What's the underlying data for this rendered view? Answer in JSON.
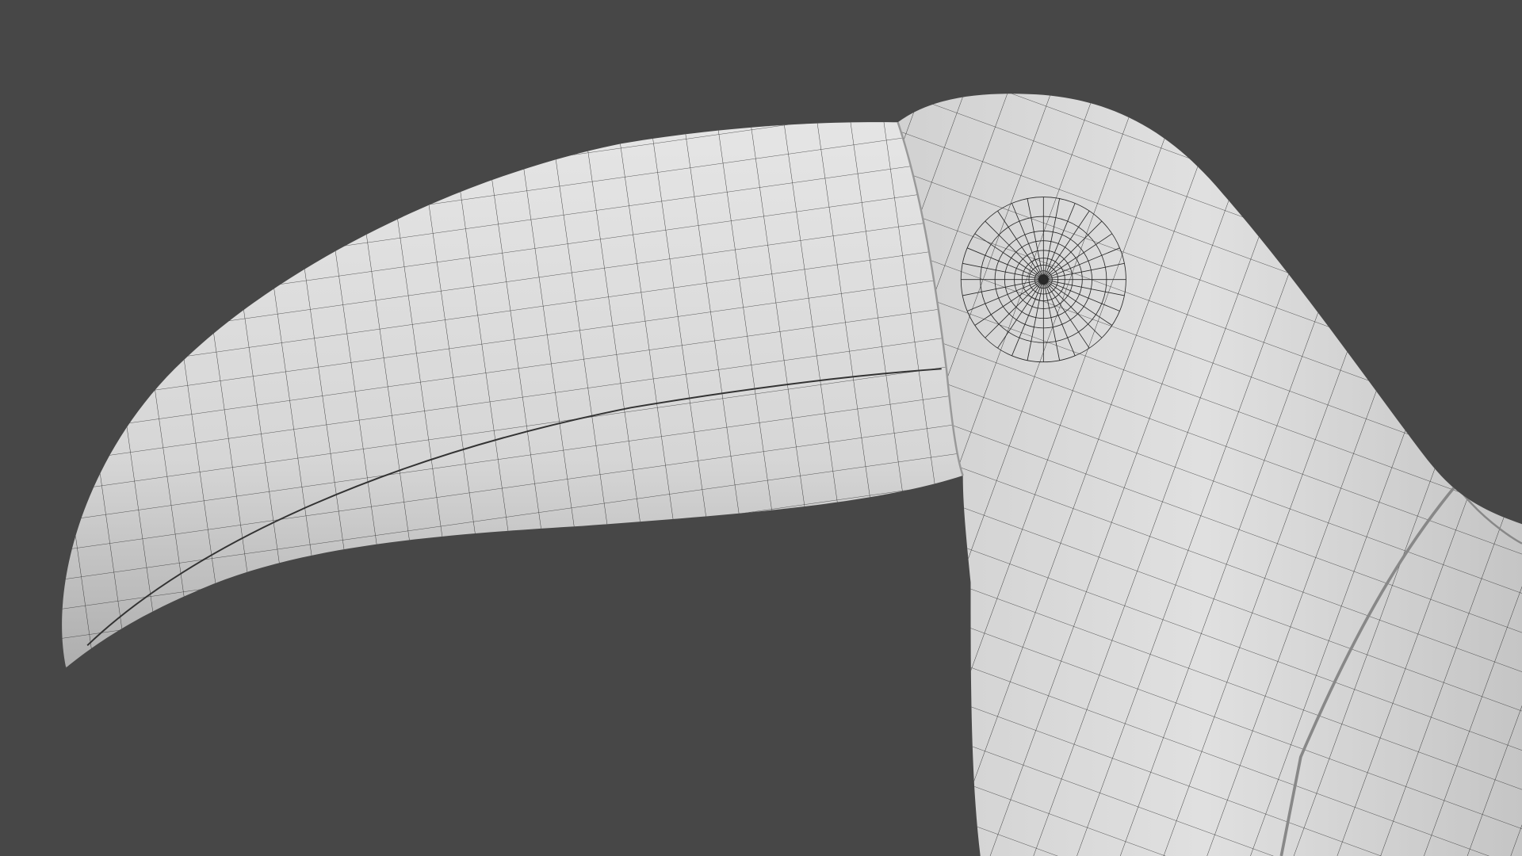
{
  "scene": {
    "subject": "toucan",
    "colors": {
      "background": "#474747",
      "surface_light": "#e2e2e2",
      "surface_dark": "#a9a9a9",
      "wire": "#2a2a2a"
    }
  }
}
